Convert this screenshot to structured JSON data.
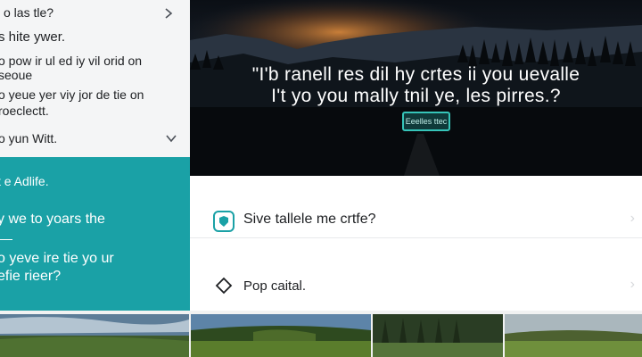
{
  "sidebar": {
    "faq": [
      {
        "lines": [
          "o las tle?"
        ]
      },
      {
        "lines": [
          "s hite ywer."
        ]
      },
      {
        "lines": [
          "o pow ir ul ed iy vil orid on",
          "seoue"
        ]
      },
      {
        "lines": [
          "o yeue yer viy jor de tie on",
          "roeclectt."
        ]
      },
      {
        "lines": [
          "o yun Witt."
        ]
      }
    ],
    "promo": {
      "heading": "t e Adlife.",
      "line1": "y we to yoars the",
      "line2": "o yeve ire tie yo ur",
      "line3": "efie rieer?"
    }
  },
  "hero": {
    "title_line1": "\"I'b ranell res dil hy crtes ii you uevalle",
    "title_line2": "I't yo you mally tnil ye, les pirres.?",
    "button_label": "Eeelles ttec"
  },
  "options": [
    {
      "label": "Sive tallele me crtfe?",
      "icon": "shield-badge-icon"
    },
    {
      "label": "Pop caital.",
      "icon": "diamond-icon"
    }
  ],
  "colors": {
    "accent": "#1aa1a6",
    "hero_dark": "#0c1218",
    "sunset": "#c9782f",
    "button_border": "#36c5b9"
  }
}
